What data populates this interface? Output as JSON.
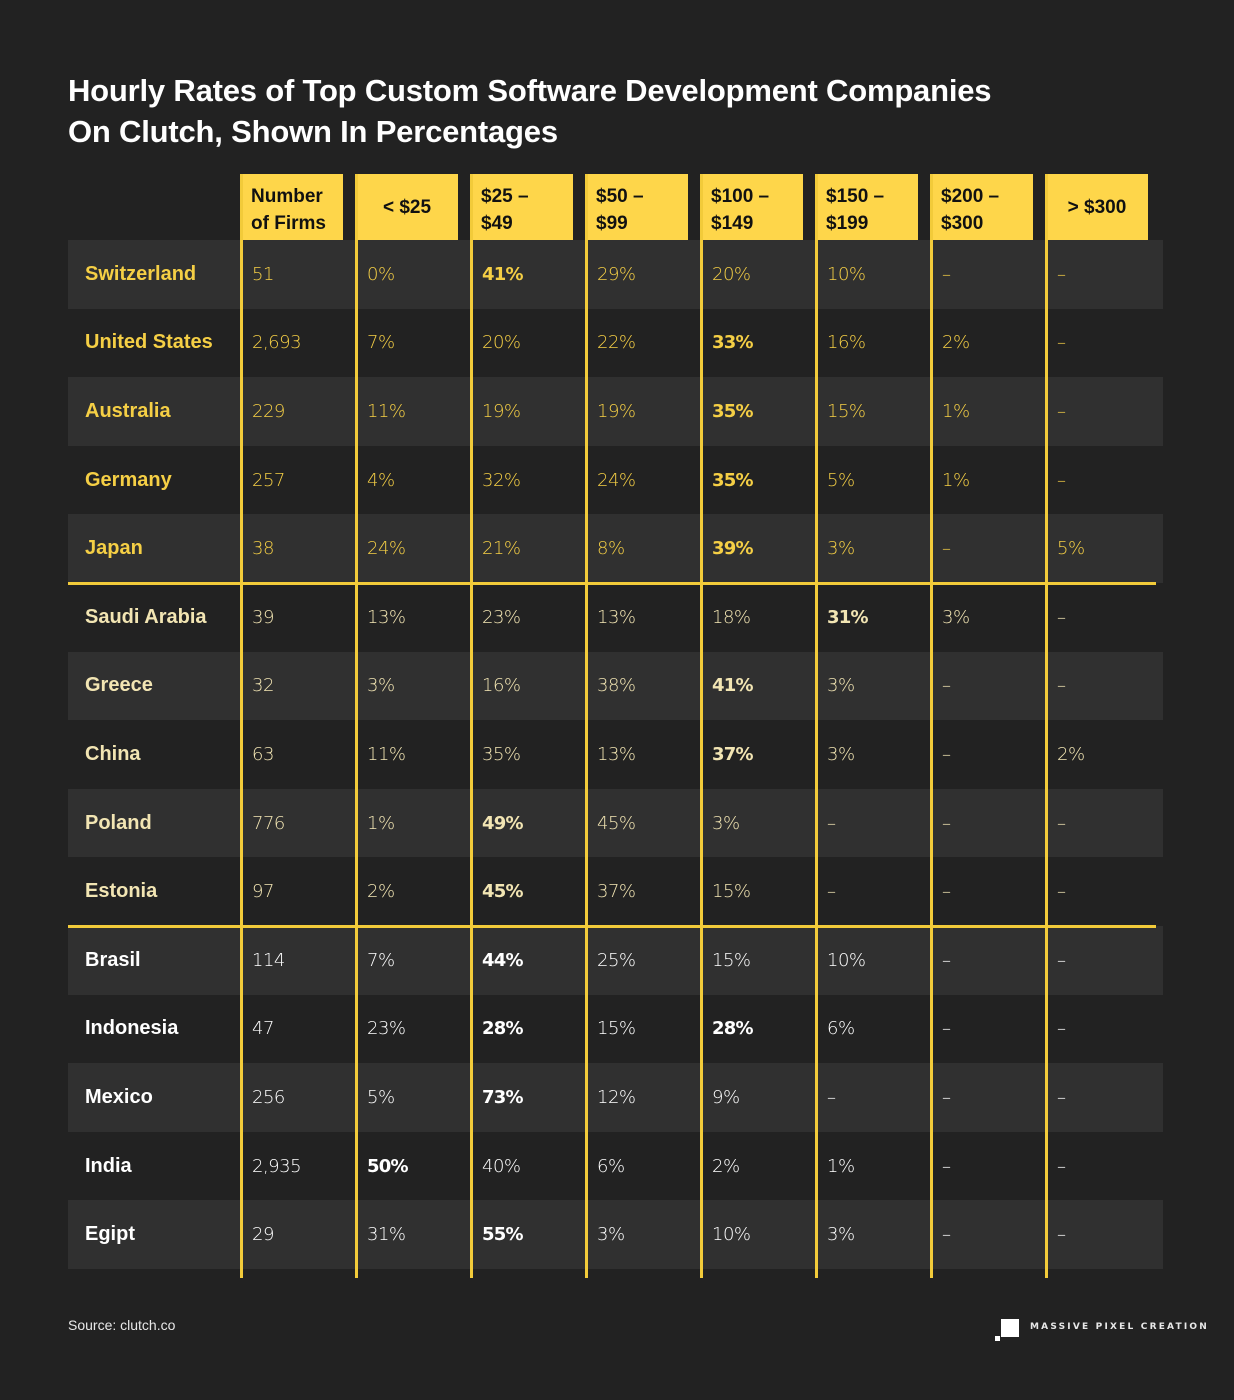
{
  "title": {
    "line1": "Hourly Rates of Top Custom Software Development Companies",
    "line2": "On Clutch, Shown In Percentages"
  },
  "colors": {
    "background": "#222222",
    "header_fill": "#fed64a",
    "grid_lines": "#f2cb3a",
    "group1_text": "#f5cf45",
    "group2_text": "#f2e5b3",
    "group3_text": "#ffffff",
    "row_light": "#303030",
    "row_dark": "#222222"
  },
  "chart_data": {
    "type": "table",
    "title": "Hourly Rates of Top Custom Software Development Companies On Clutch, Shown In Percentages",
    "columns": [
      {
        "line1": "Number",
        "line2": "of Firms"
      },
      {
        "line1": "< $25",
        "line2": ""
      },
      {
        "line1": "$25 –",
        "line2": "$49"
      },
      {
        "line1": "$50 –",
        "line2": "$99"
      },
      {
        "line1": "$100 –",
        "line2": "$149"
      },
      {
        "line1": "$150 –",
        "line2": "$199"
      },
      {
        "line1": "$200 –",
        "line2": "$300"
      },
      {
        "line1": "> $300",
        "line2": ""
      }
    ],
    "groups": [
      {
        "rows": [
          {
            "country": "Switzerland",
            "values": [
              "51",
              "0%",
              "41%",
              "29%",
              "20%",
              "10%",
              "–",
              "–"
            ],
            "highlight": [
              2
            ]
          },
          {
            "country": "United States",
            "values": [
              "2,693",
              "7%",
              "20%",
              "22%",
              "33%",
              "16%",
              "2%",
              "–"
            ],
            "highlight": [
              4
            ]
          },
          {
            "country": "Australia",
            "values": [
              "229",
              "11%",
              "19%",
              "19%",
              "35%",
              "15%",
              "1%",
              "–"
            ],
            "highlight": [
              4
            ]
          },
          {
            "country": "Germany",
            "values": [
              "257",
              "4%",
              "32%",
              "24%",
              "35%",
              "5%",
              "1%",
              "–"
            ],
            "highlight": [
              4
            ]
          },
          {
            "country": "Japan",
            "values": [
              "38",
              "24%",
              "21%",
              "8%",
              "39%",
              "3%",
              "–",
              "5%"
            ],
            "highlight": [
              4
            ]
          }
        ]
      },
      {
        "rows": [
          {
            "country": "Saudi Arabia",
            "values": [
              "39",
              "13%",
              "23%",
              "13%",
              "18%",
              "31%",
              "3%",
              "–"
            ],
            "highlight": [
              5
            ]
          },
          {
            "country": "Greece",
            "values": [
              "32",
              "3%",
              "16%",
              "38%",
              "41%",
              "3%",
              "–",
              "–"
            ],
            "highlight": [
              4
            ]
          },
          {
            "country": "China",
            "values": [
              "63",
              "11%",
              "35%",
              "13%",
              "37%",
              "3%",
              "–",
              "2%"
            ],
            "highlight": [
              4
            ]
          },
          {
            "country": "Poland",
            "values": [
              "776",
              "1%",
              "49%",
              "45%",
              "3%",
              "–",
              "–",
              "–"
            ],
            "highlight": [
              2
            ]
          },
          {
            "country": "Estonia",
            "values": [
              "97",
              "2%",
              "45%",
              "37%",
              "15%",
              "–",
              "–",
              "–"
            ],
            "highlight": [
              2
            ]
          }
        ]
      },
      {
        "rows": [
          {
            "country": "Brasil",
            "values": [
              "114",
              "7%",
              "44%",
              "25%",
              "15%",
              "10%",
              "–",
              "–"
            ],
            "highlight": [
              2
            ]
          },
          {
            "country": "Indonesia",
            "values": [
              "47",
              "23%",
              "28%",
              "15%",
              "28%",
              "6%",
              "–",
              "–"
            ],
            "highlight": [
              2,
              4
            ]
          },
          {
            "country": "Mexico",
            "values": [
              "256",
              "5%",
              "73%",
              "12%",
              "9%",
              "–",
              "–",
              "–"
            ],
            "highlight": [
              2
            ]
          },
          {
            "country": "India",
            "values": [
              "2,935",
              "50%",
              "40%",
              "6%",
              "2%",
              "1%",
              "–",
              "–"
            ],
            "highlight": [
              1
            ]
          },
          {
            "country": "Egipt",
            "values": [
              "29",
              "31%",
              "55%",
              "3%",
              "10%",
              "3%",
              "–",
              "–"
            ],
            "highlight": [
              2
            ]
          }
        ]
      }
    ]
  },
  "footer": {
    "source": "Source: clutch.co",
    "brand": "MASSIVE PIXEL CREATION"
  }
}
